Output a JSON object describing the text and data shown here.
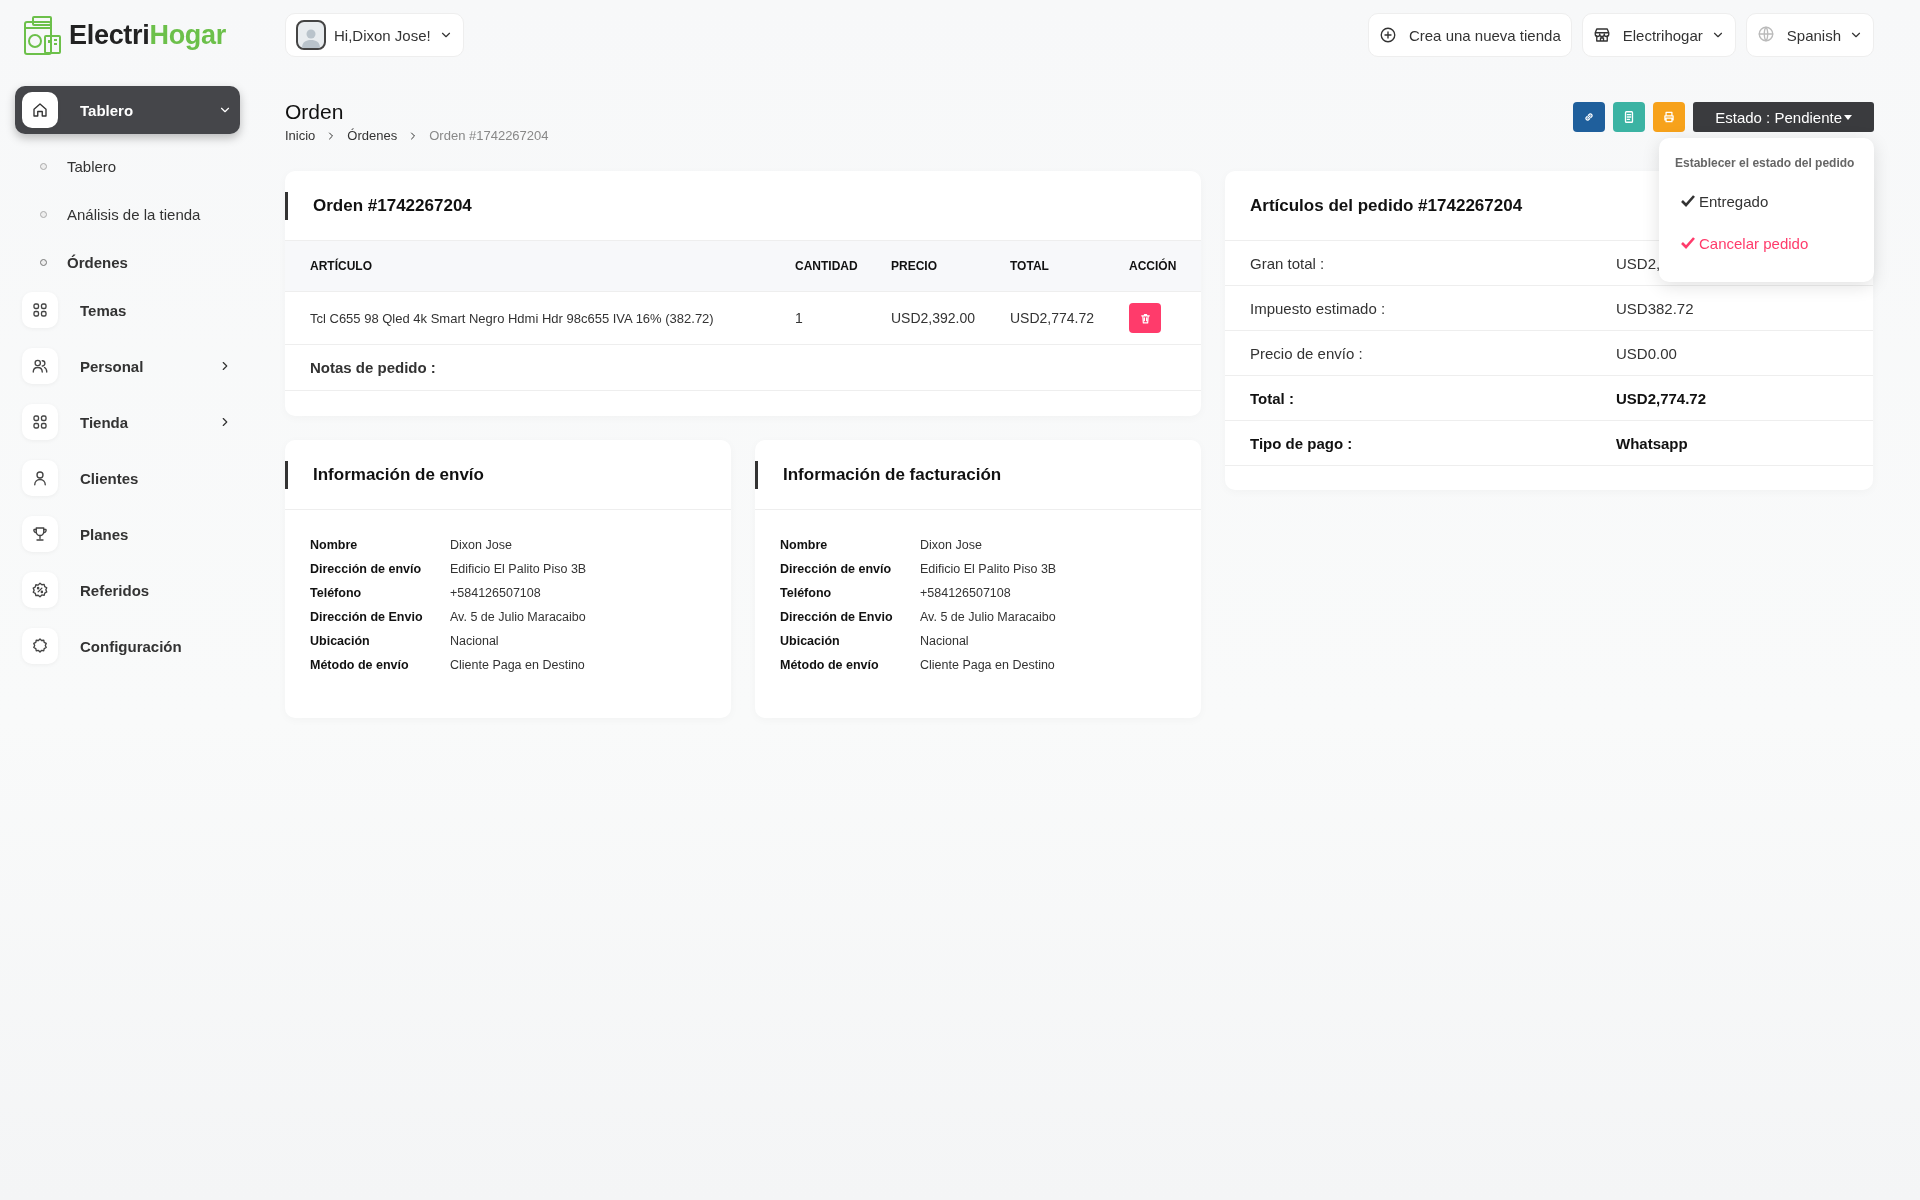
{
  "logo": {
    "first": "Electri",
    "second": "Hogar"
  },
  "user_menu": {
    "label": "Hi,Dixon Jose!"
  },
  "top_actions": [
    {
      "kind": "create",
      "label": "Crea una nueva tienda"
    },
    {
      "kind": "store",
      "label": "Electrihogar"
    },
    {
      "kind": "language",
      "label": "Spanish"
    }
  ],
  "sidebar": {
    "items": [
      {
        "label": "Tablero",
        "selected": true,
        "expanded": true,
        "children": [
          {
            "label": "Tablero",
            "selected": false
          },
          {
            "label": "Análisis de la tienda",
            "selected": false
          },
          {
            "label": "Órdenes",
            "selected": true
          }
        ]
      },
      {
        "label": "Temas",
        "selected": false
      },
      {
        "label": "Personal",
        "selected": false,
        "expanded": false
      },
      {
        "label": "Tienda",
        "selected": false,
        "expanded": false
      },
      {
        "label": "Clientes",
        "selected": false
      },
      {
        "label": "Planes",
        "selected": false
      },
      {
        "label": "Referidos",
        "selected": false
      },
      {
        "label": "Configuración",
        "selected": false
      }
    ]
  },
  "page": {
    "title": "Orden",
    "breadcrumb": [
      "Inicio",
      "Órdenes",
      "Orden #1742267204"
    ]
  },
  "toolbar": {
    "icon_buttons": [
      {
        "kind": "link",
        "color": "#1f5f9c"
      },
      {
        "kind": "document",
        "color": "#3bb3a3"
      },
      {
        "kind": "print",
        "color": "#f7a21b"
      }
    ],
    "status_button": "Estado : Pendiente",
    "status_menu": {
      "header": "Establecer el estado del pedido",
      "options": [
        {
          "label": "Entregado",
          "color": "#333333"
        },
        {
          "label": "Cancelar pedido",
          "color": "#ff3b6b"
        }
      ]
    }
  },
  "order_card": {
    "title": "Orden #1742267204",
    "columns": [
      "ARTÍCULO",
      "CANTIDAD",
      "PRECIO",
      "TOTAL",
      "ACCIÓN"
    ],
    "rows": [
      {
        "cells": [
          "Tcl C655 98 Qled 4k Smart Negro Hdmi Hdr 98c655 IVA 16% (382.72)",
          "1",
          "USD2,392.00",
          "USD2,774.72"
        ]
      }
    ],
    "notes_label": "Notas de pedido :"
  },
  "summary_card": {
    "title": "Artículos del pedido #1742267204",
    "rows": [
      {
        "label": "Gran total :",
        "value": "USD2,",
        "bold": false
      },
      {
        "label": "Impuesto estimado :",
        "value": "USD382.72",
        "bold": false
      },
      {
        "label": "Precio de envío :",
        "value": "USD0.00",
        "bold": false
      },
      {
        "label": "Total :",
        "value": "USD2,774.72",
        "bold": true
      },
      {
        "label": "Tipo de pago :",
        "value": "Whatsapp",
        "bold": true
      }
    ]
  },
  "info_cards": [
    {
      "title": "Información de envío",
      "fields": [
        {
          "label": "Nombre",
          "value": "Dixon Jose"
        },
        {
          "label": "Dirección de envío",
          "value": "Edificio El Palito Piso 3B"
        },
        {
          "label": "Teléfono",
          "value": "+584126507108"
        },
        {
          "label": "Dirección de Envio",
          "value": "Av. 5 de Julio Maracaibo"
        },
        {
          "label": "Ubicación",
          "value": "Nacional"
        },
        {
          "label": "Método de envío",
          "value": "Cliente Paga en Destino"
        }
      ]
    },
    {
      "title": "Información de facturación",
      "fields": [
        {
          "label": "Nombre",
          "value": "Dixon Jose"
        },
        {
          "label": "Dirección de envío",
          "value": "Edificio El Palito Piso 3B"
        },
        {
          "label": "Teléfono",
          "value": "+584126507108"
        },
        {
          "label": "Dirección de Envio",
          "value": "Av. 5 de Julio Maracaibo"
        },
        {
          "label": "Ubicación",
          "value": "Nacional"
        },
        {
          "label": "Método de envío",
          "value": "Cliente Paga en Destino"
        }
      ]
    }
  ]
}
